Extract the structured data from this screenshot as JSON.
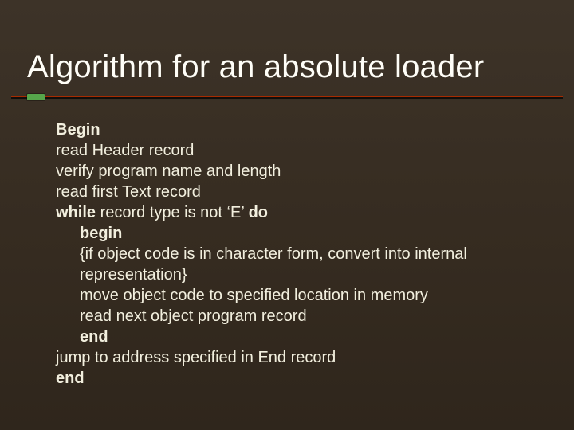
{
  "slide": {
    "title": "Algorithm for an absolute loader"
  },
  "algo": {
    "l0_b": "Begin",
    "l1": "read Header record",
    "l2": "verify program name and length",
    "l3": "read first Text record",
    "l4_b1": "while",
    "l4_m": " record type is not ‘E’ ",
    "l4_b2": "do",
    "l5_b": "begin",
    "l6": "{if object code is in character form, convert into internal",
    "l7": "representation}",
    "l8": "move object code to specified location in memory",
    "l9": "read next object program record",
    "l10_b": "end",
    "l11": "jump to address specified in End record",
    "l12_b": "end"
  }
}
